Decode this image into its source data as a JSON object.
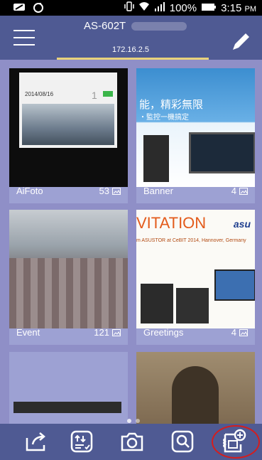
{
  "status_bar": {
    "battery": "100%",
    "time": "3:15",
    "ampm": "PM"
  },
  "header": {
    "device_name": "AS-602T",
    "ip_address": "172.16.2.5"
  },
  "albums": [
    {
      "name": "AiFoto",
      "count": "53",
      "thumb_date": "2014/08/16",
      "thumb_badge": "1"
    },
    {
      "name": "Banner",
      "count": "4",
      "banner_text": "能，精彩無限",
      "banner_sub": "・監控一機搞定"
    },
    {
      "name": "Event",
      "count": "121"
    },
    {
      "name": "Greetings",
      "count": "4",
      "card_title": "VITATION",
      "card_logo": "asu",
      "card_sub": "m ASUSTOR at CeBIT 2014, Hannover, Germany"
    },
    {
      "name": "",
      "count": ""
    },
    {
      "name": "",
      "count": ""
    }
  ],
  "bottom_bar": {
    "icons": [
      "share-icon",
      "sort-icon",
      "camera-icon",
      "search-icon",
      "add-album-icon"
    ]
  },
  "colors": {
    "appbar": "#4f5a93",
    "content_bg": "#8f8fc7",
    "tile_bg": "#9da1d3",
    "accent_underline": "#e9d27b",
    "highlight_ring": "#d51d1d"
  }
}
